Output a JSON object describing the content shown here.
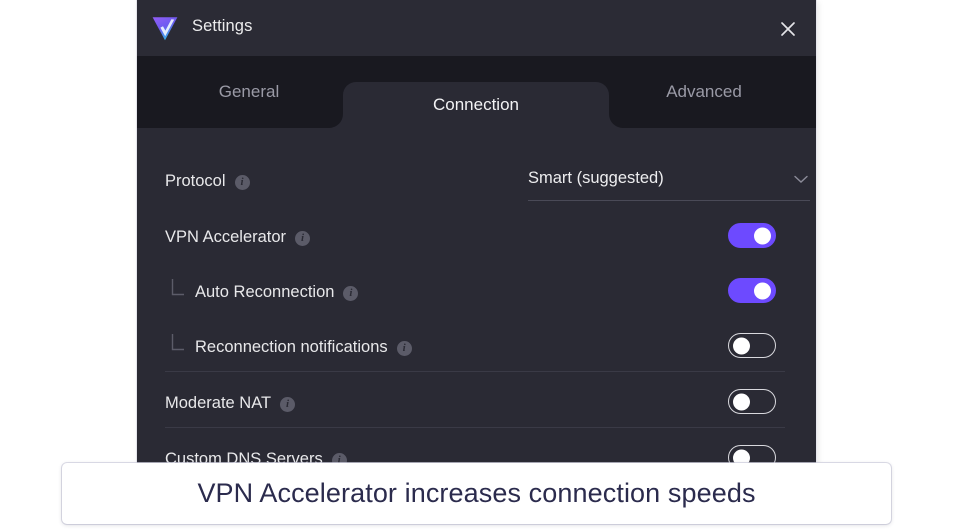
{
  "window": {
    "title": "Settings",
    "logo_icon": "protonvpn-logo-icon",
    "close_icon": "close-icon"
  },
  "tabs": [
    {
      "label": "General",
      "active": false
    },
    {
      "label": "Connection",
      "active": true
    },
    {
      "label": "Advanced",
      "active": false
    }
  ],
  "settings": {
    "protocol": {
      "label": "Protocol",
      "info_icon": "info-icon",
      "value": "Smart (suggested)",
      "chevron_icon": "chevron-down-icon"
    },
    "vpn_accelerator": {
      "label": "VPN Accelerator",
      "info_icon": "info-icon",
      "state": "on"
    },
    "auto_reconnection": {
      "label": "Auto Reconnection",
      "info_icon": "info-icon",
      "branch_icon": "branch-corner-icon",
      "state": "on"
    },
    "reconnection_notifications": {
      "label": "Reconnection notifications",
      "info_icon": "info-icon",
      "branch_icon": "branch-corner-icon",
      "state": "off"
    },
    "moderate_nat": {
      "label": "Moderate NAT",
      "info_icon": "info-icon",
      "state": "off"
    },
    "custom_dns_servers": {
      "label": "Custom DNS Servers",
      "info_icon": "info-icon",
      "state": "off"
    }
  },
  "caption": {
    "text": "VPN Accelerator increases connection speeds"
  },
  "colors": {
    "accent_toggle_on": "#6d4aff",
    "window_bg": "#2a2a34",
    "tabstrip_bg": "#191920",
    "caption_text": "#2b2b4d"
  },
  "info_glyph": "i"
}
